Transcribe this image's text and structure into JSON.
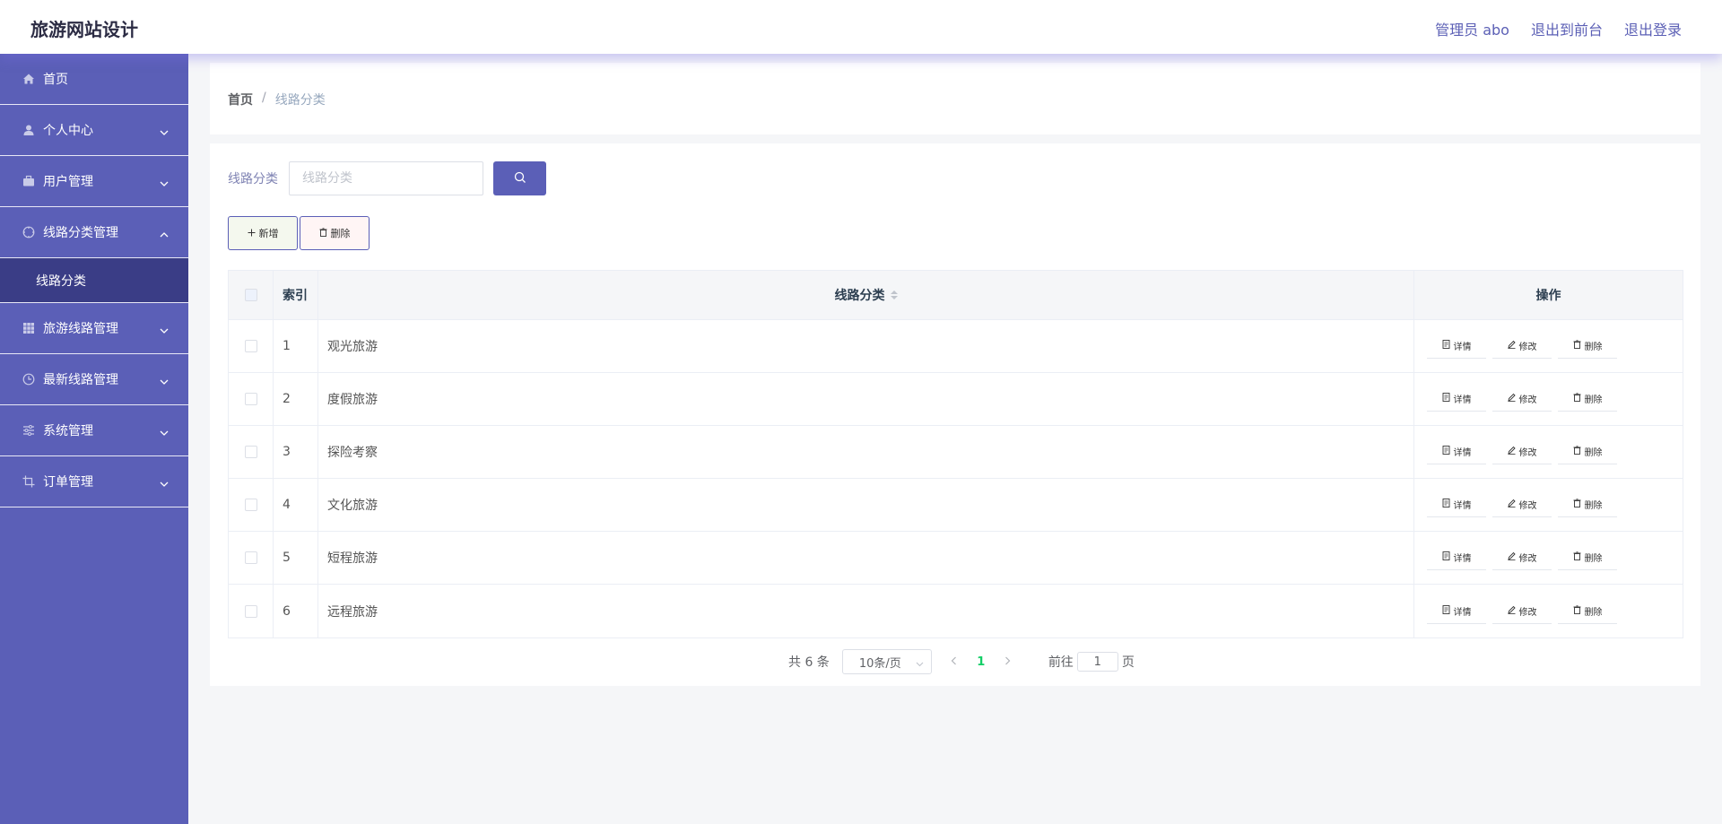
{
  "header": {
    "title": "旅游网站设计",
    "user": "管理员 abo",
    "to_front": "退出到前台",
    "logout": "退出登录"
  },
  "sidebar": {
    "items": [
      {
        "label": "首页",
        "icon": "home-icon"
      },
      {
        "label": "个人中心",
        "icon": "user-icon"
      },
      {
        "label": "用户管理",
        "icon": "briefcase-icon"
      },
      {
        "label": "线路分类管理",
        "icon": "compass-icon",
        "expanded": true,
        "children": [
          "线路分类"
        ]
      },
      {
        "label": "旅游线路管理",
        "icon": "grid-icon"
      },
      {
        "label": "最新线路管理",
        "icon": "clock-icon"
      },
      {
        "label": "系统管理",
        "icon": "sliders-icon"
      },
      {
        "label": "订单管理",
        "icon": "crop-icon"
      }
    ]
  },
  "breadcrumb": {
    "home": "首页",
    "separator": "/",
    "current": "线路分类"
  },
  "search": {
    "label": "线路分类",
    "placeholder": "线路分类",
    "value": ""
  },
  "actions": {
    "add": "新增",
    "delete": "删除"
  },
  "table": {
    "headers": {
      "index": "索引",
      "name": "线路分类",
      "ops": "操作"
    },
    "op_labels": {
      "detail": "详情",
      "edit": "修改",
      "delete": "删除"
    },
    "rows": [
      {
        "index": "1",
        "name": "观光旅游"
      },
      {
        "index": "2",
        "name": "度假旅游"
      },
      {
        "index": "3",
        "name": "探险考察"
      },
      {
        "index": "4",
        "name": "文化旅游"
      },
      {
        "index": "5",
        "name": "短程旅游"
      },
      {
        "index": "6",
        "name": "远程旅游"
      }
    ]
  },
  "pagination": {
    "total": "共 6 条",
    "page_size": "10条/页",
    "current_page": "1",
    "goto_prefix": "前往",
    "goto_value": "1",
    "goto_suffix": "页"
  },
  "colors": {
    "accent": "#5b5fb7",
    "sidebar_active": "#3a3d86",
    "page_active": "#13ce66"
  }
}
